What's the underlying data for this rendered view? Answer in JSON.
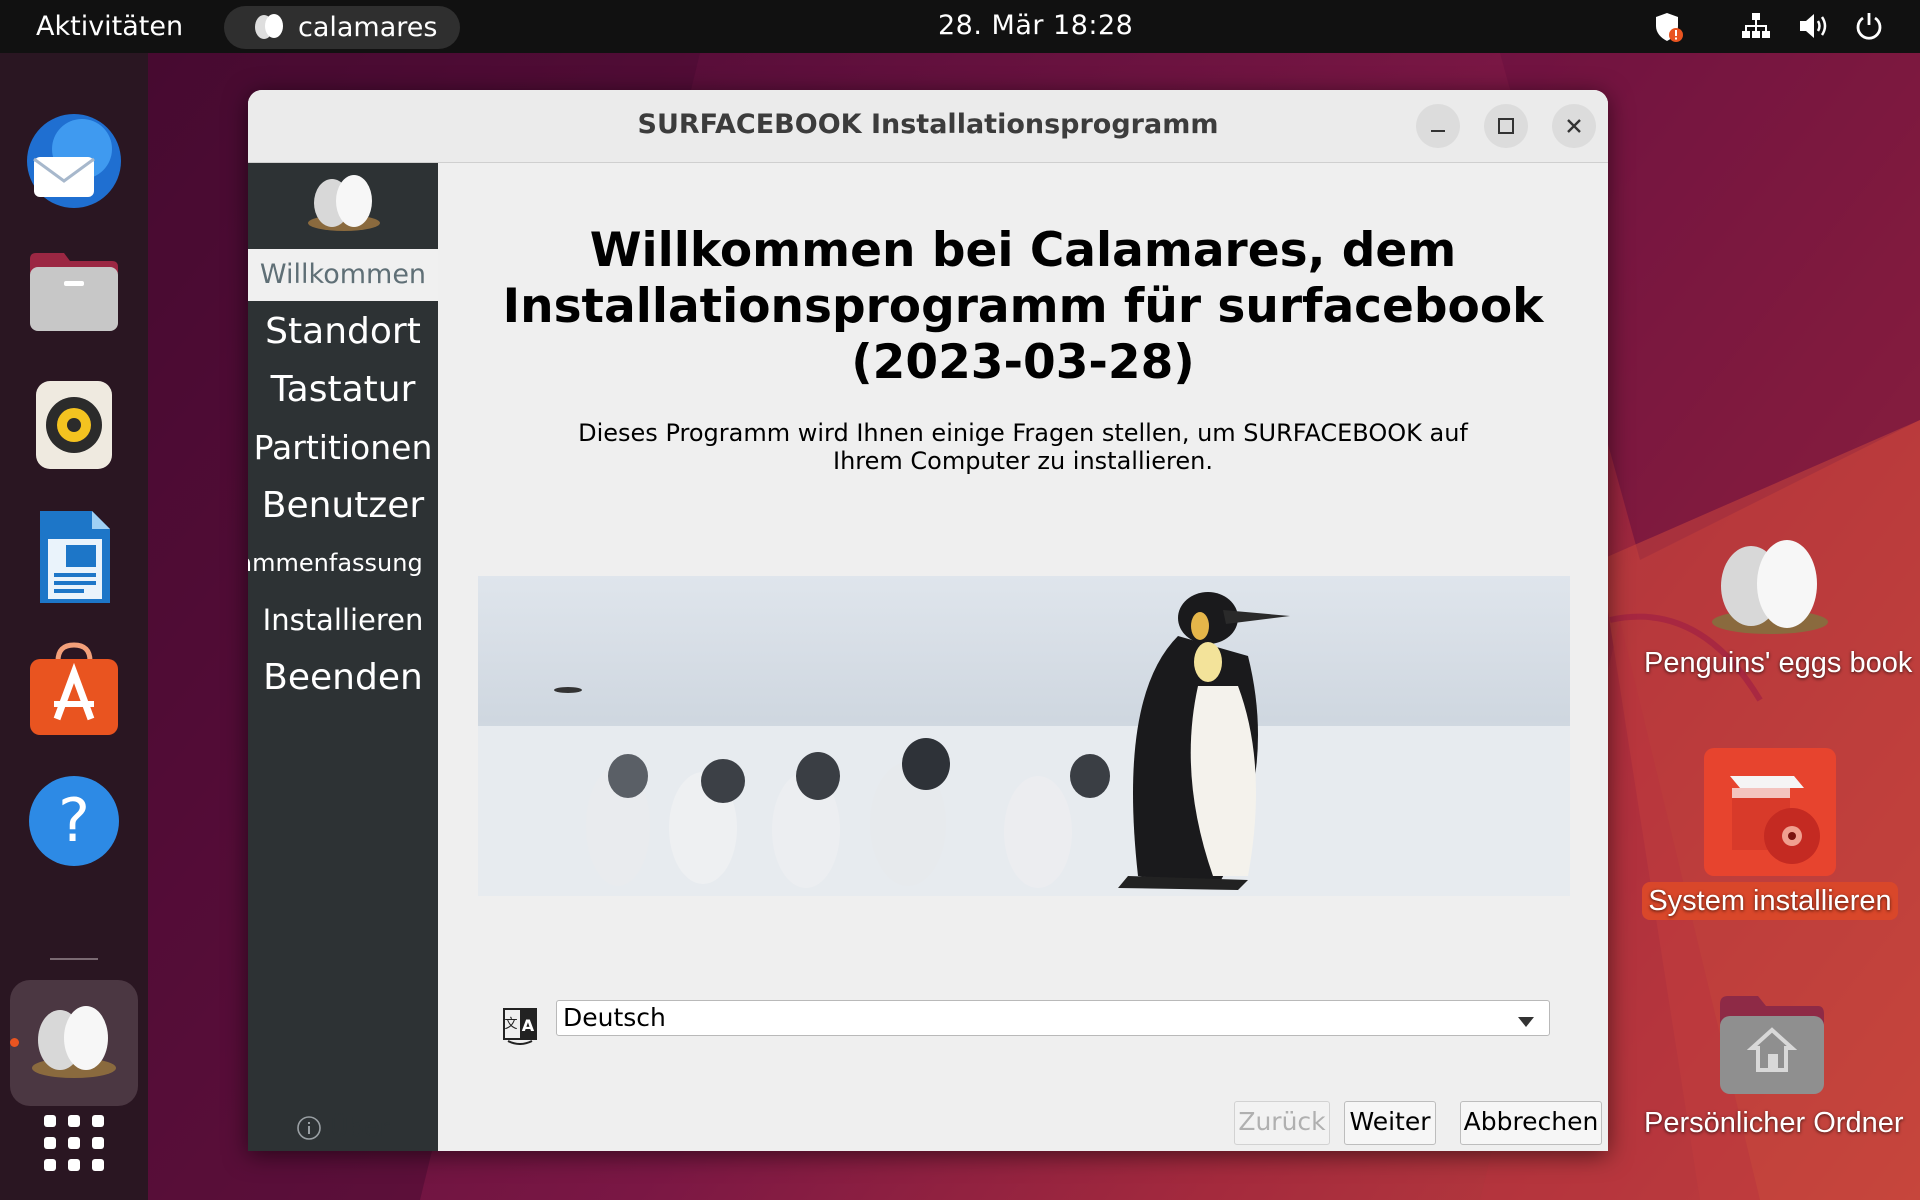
{
  "topbar": {
    "activities": "Aktivitäten",
    "app_name": "calamares",
    "clock": "28. Mär  18:28",
    "tray_icons": [
      "shield-alert-icon",
      "network-icon",
      "volume-icon",
      "power-icon"
    ]
  },
  "dock": {
    "items": [
      "thunderbird-icon",
      "files-icon",
      "rhythmbox-icon",
      "writer-icon",
      "app-center-icon",
      "help-icon",
      "penguins-eggs-icon",
      "show-apps-grid-icon"
    ],
    "running_indicator_color": "#e95420"
  },
  "desktop": {
    "icons": [
      {
        "label": "Penguins' eggs book"
      },
      {
        "label": "System installieren"
      },
      {
        "label": "Persönlicher Ordner"
      }
    ]
  },
  "window": {
    "title": "SURFACEBOOK Installationsprogramm",
    "sidebar": {
      "steps": [
        {
          "label": "Willkommen"
        },
        {
          "label": "Standort"
        },
        {
          "label": "Tastatur"
        },
        {
          "label": "Partitionen"
        },
        {
          "label": "Benutzer"
        },
        {
          "label": "Zusammenfassung"
        },
        {
          "label": "Installieren"
        },
        {
          "label": "Beenden"
        }
      ],
      "about_label": "Über"
    },
    "content": {
      "heading": "Willkommen bei Calamares, dem Installationsprogramm für surfacebook (2023-03-28)",
      "description": "Dieses Programm wird Ihnen einige Fragen stellen, um SURFACEBOOK auf Ihrem Computer zu installieren.",
      "language": "Deutsch"
    },
    "buttons": {
      "back": "Zurück",
      "next": "Weiter",
      "cancel": "Abbrechen"
    }
  },
  "colors": {
    "accent": "#e95420",
    "sidebar": "#2d3234",
    "topbar": "#111111"
  }
}
